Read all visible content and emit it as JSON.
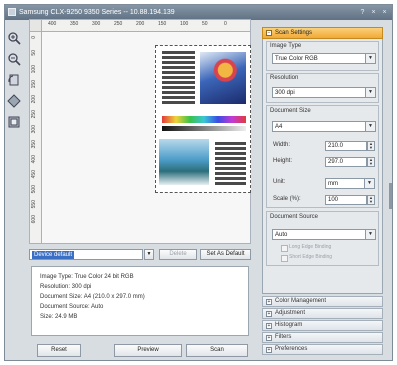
{
  "window": {
    "title": "Samsung CLX-9250 9350 Series -- 10.88.194.139",
    "controls": [
      "?",
      "×",
      "×"
    ]
  },
  "toolbar": {
    "tools": [
      {
        "name": "zoom-in-icon"
      },
      {
        "name": "zoom-out-icon"
      },
      {
        "name": "rotate-icon"
      },
      {
        "name": "flip-icon"
      },
      {
        "name": "crop-icon"
      }
    ]
  },
  "ruler": {
    "top": [
      "400",
      "350",
      "300",
      "250",
      "200",
      "150",
      "100",
      "50",
      "0"
    ],
    "left": [
      "0",
      "50",
      "100",
      "150",
      "200",
      "250",
      "300",
      "350",
      "400",
      "450",
      "500",
      "550",
      "600"
    ]
  },
  "scan_area": {
    "preset_value": "Device default",
    "delete_label": "Delete",
    "set_default_label": "Set As Default"
  },
  "info": [
    "Image Type: True Color 24 bit RGB",
    "Resolution: 300 dpi",
    "Document Size: A4 (210.0 x 297.0 mm)",
    "Document Source: Auto",
    "Size: 24.9 MB"
  ],
  "actions": {
    "reset": "Reset",
    "preview": "Preview",
    "scan": "Scan"
  },
  "panel": {
    "header": "Scan Settings",
    "image_type_label": "Image Type",
    "image_type_value": "True Color RGB",
    "resolution_label": "Resolution",
    "resolution_value": "300 dpi",
    "document_size_label": "Document Size",
    "document_size_value": "A4",
    "width_label": "Width:",
    "width_value": "210.0",
    "height_label": "Height:",
    "height_value": "297.0",
    "unit_label": "Unit:",
    "unit_value": "mm",
    "scale_label": "Scale (%):",
    "scale_value": "100",
    "document_source_label": "Document Source",
    "document_source_value": "Auto",
    "long_edge": "Long Edge Binding",
    "short_edge": "Short Edge Binding"
  },
  "sections": [
    "Color Management",
    "Adjustment",
    "Histogram",
    "Filters",
    "Preferences"
  ]
}
